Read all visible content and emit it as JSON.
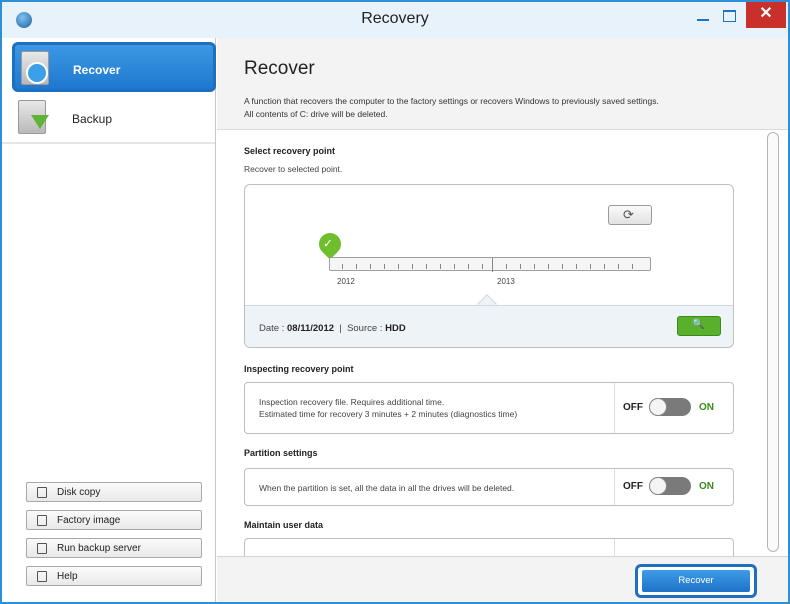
{
  "window": {
    "title": "Recovery",
    "close_glyph": "✕"
  },
  "sidebar": {
    "items": [
      {
        "label": "Recover",
        "icon": "recover-disk-icon"
      },
      {
        "label": "Backup",
        "icon": "backup-disk-icon"
      }
    ],
    "buttons": [
      {
        "label": "Disk copy",
        "icon": "disk-copy-icon"
      },
      {
        "label": "Factory image",
        "icon": "factory-image-icon"
      },
      {
        "label": "Run backup server",
        "icon": "backup-server-icon"
      },
      {
        "label": "Help",
        "icon": "help-icon"
      }
    ]
  },
  "header": {
    "title": "Recover",
    "desc_line1": "A function that recovers the computer to the factory settings or recovers Windows to previously saved settings.",
    "desc_line2": "All contents of C: drive will be deleted."
  },
  "recovery_point": {
    "title": "Select recovery point",
    "subtitle": "Recover to selected point.",
    "years": [
      "2012",
      "2013"
    ],
    "date_label": "Date :",
    "date_value": "08/11/2012",
    "separator": "|",
    "source_label": "Source :",
    "source_value": "HDD"
  },
  "inspecting": {
    "title": "Inspecting recovery point",
    "line1": "Inspection recovery file. Requires additional time.",
    "line2": "Estimated time for recovery 3 minutes + 2 minutes (diagnostics time)",
    "off": "OFF",
    "on": "ON",
    "state": "off"
  },
  "partition": {
    "title": "Partition settings",
    "text": "When the partition is set, all the data in all the drives will be deleted.",
    "off": "OFF",
    "on": "ON",
    "state": "off"
  },
  "maintain": {
    "title": "Maintain user data"
  },
  "footer": {
    "recover_label": "Recover"
  },
  "colors": {
    "accent": "#1f78cf",
    "green": "#58b02d",
    "close": "#c9302c"
  }
}
